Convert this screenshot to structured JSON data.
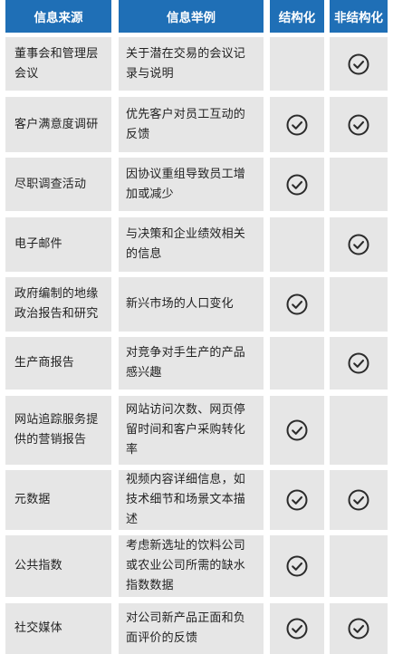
{
  "headers": [
    "信息来源",
    "信息举例",
    "结构化",
    "非结构化"
  ],
  "colors": {
    "header_bg": "#1f6fb6",
    "cell_gray": "#e6e6e6",
    "check_color": "#2b2b2b"
  },
  "rows": [
    {
      "source": "董事会和管理层会议",
      "example": "关于潜在交易的会议记录与说明",
      "structured": false,
      "unstructured": true
    },
    {
      "source": "客户满意度调研",
      "example": "优先客户对员工互动的反馈",
      "structured": true,
      "unstructured": true
    },
    {
      "source": "尽职调查活动",
      "example": "因协议重组导致员工增加或减少",
      "structured": true,
      "unstructured": false
    },
    {
      "source": "电子邮件",
      "example": "与决策和企业绩效相关的信息",
      "structured": false,
      "unstructured": true
    },
    {
      "source": "政府编制的地缘政治报告和研究",
      "example": "新兴市场的人口变化",
      "structured": true,
      "unstructured": false
    },
    {
      "source": "生产商报告",
      "example": "对竞争对手生产的产品感兴趣",
      "structured": false,
      "unstructured": true
    },
    {
      "source": "网站追踪服务提供的营销报告",
      "example": "网站访问次数、网页停留时间和客户采购转化率",
      "structured": true,
      "unstructured": false
    },
    {
      "source": "元数据",
      "example": "视频内容详细信息，如技术细节和场景文本描述",
      "structured": true,
      "unstructured": true
    },
    {
      "source": "公共指数",
      "example": "考虑新选址的饮料公司或农业公司所需的缺水指数数据",
      "structured": true,
      "unstructured": false
    },
    {
      "source": "社交媒体",
      "example": "对公司新产品正面和负面评价的反馈",
      "structured": true,
      "unstructured": true
    }
  ]
}
